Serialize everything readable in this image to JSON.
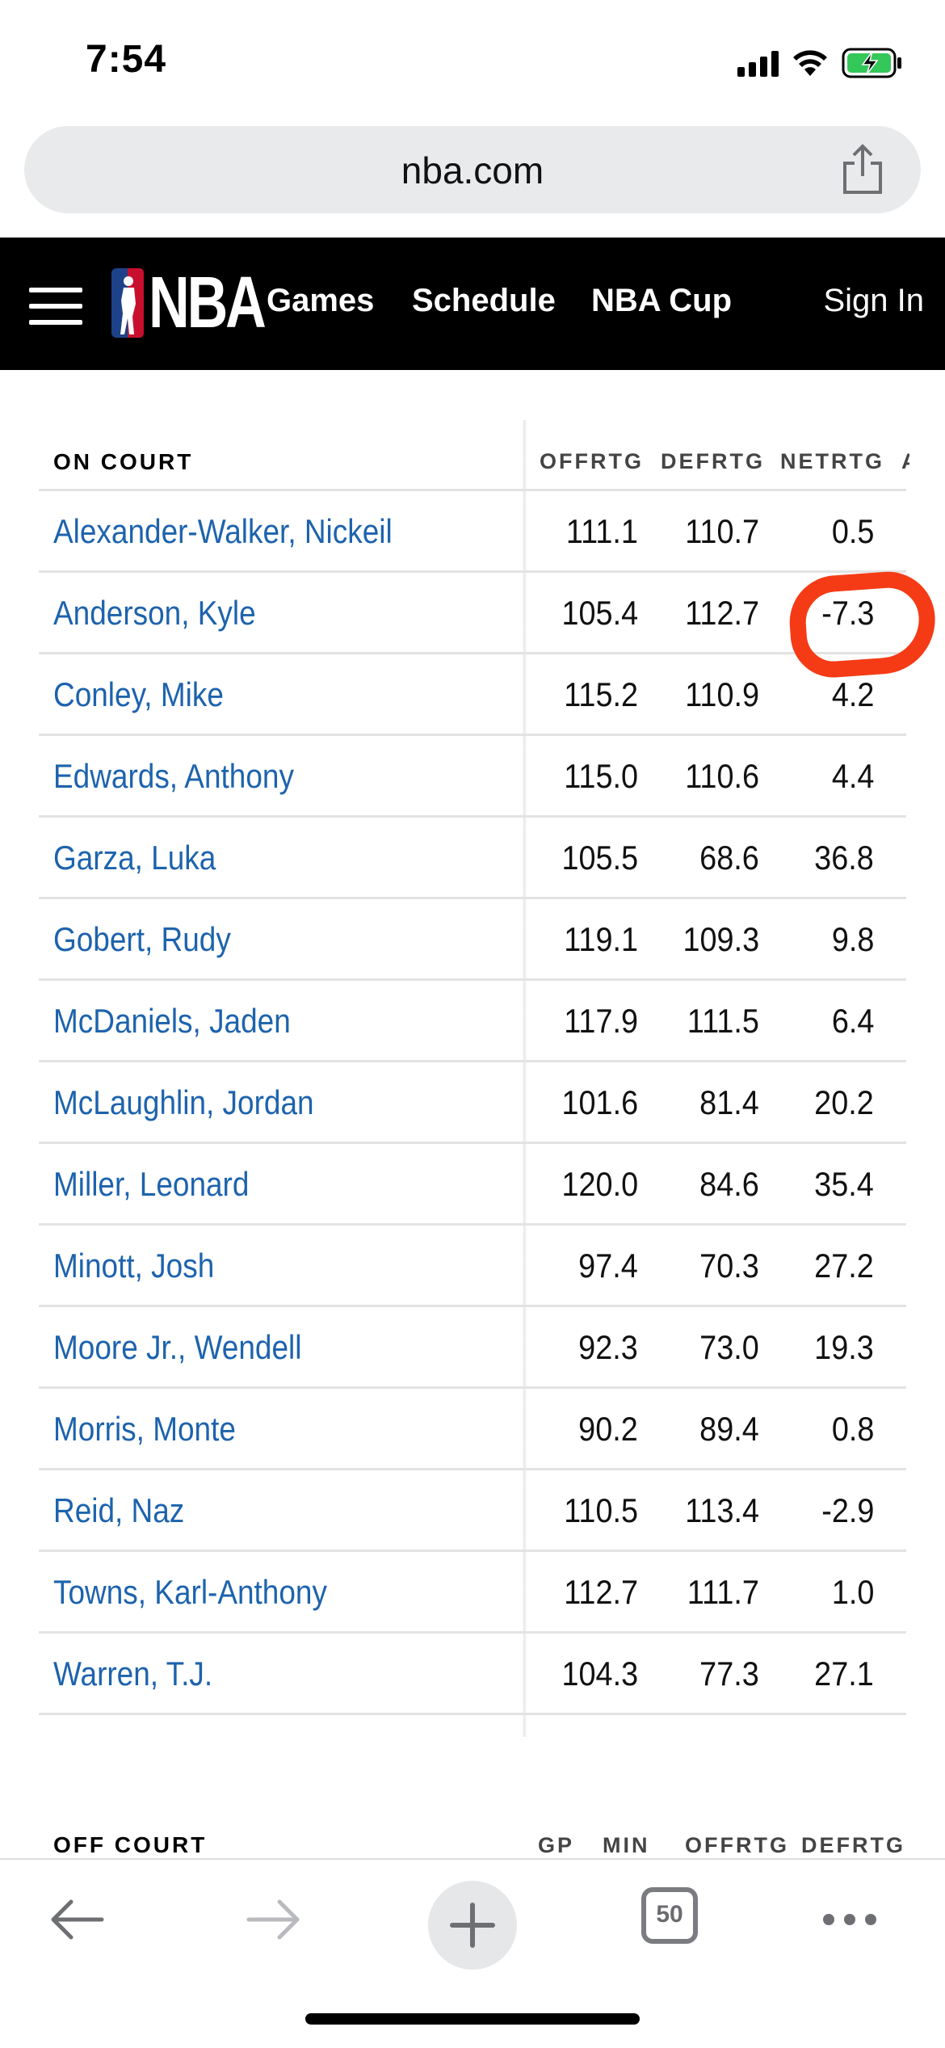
{
  "status_bar": {
    "time": "7:54"
  },
  "browser": {
    "url": "nba.com",
    "tab_count": "50"
  },
  "nav": {
    "logo_text": "NBA",
    "links": [
      "Games",
      "Schedule",
      "NBA Cup"
    ],
    "sign_in": "Sign In"
  },
  "on_court": {
    "title": "ON COURT",
    "columns": [
      "OFFRTG",
      "DEFRTG",
      "NETRTG"
    ],
    "rows": [
      {
        "player": "Alexander-Walker, Nickeil",
        "offrtg": "111.1",
        "defrtg": "110.7",
        "netrtg": "0.5"
      },
      {
        "player": "Anderson, Kyle",
        "offrtg": "105.4",
        "defrtg": "112.7",
        "netrtg": "-7.3"
      },
      {
        "player": "Conley, Mike",
        "offrtg": "115.2",
        "defrtg": "110.9",
        "netrtg": "4.2"
      },
      {
        "player": "Edwards, Anthony",
        "offrtg": "115.0",
        "defrtg": "110.6",
        "netrtg": "4.4"
      },
      {
        "player": "Garza, Luka",
        "offrtg": "105.5",
        "defrtg": "68.6",
        "netrtg": "36.8"
      },
      {
        "player": "Gobert, Rudy",
        "offrtg": "119.1",
        "defrtg": "109.3",
        "netrtg": "9.8"
      },
      {
        "player": "McDaniels, Jaden",
        "offrtg": "117.9",
        "defrtg": "111.5",
        "netrtg": "6.4"
      },
      {
        "player": "McLaughlin, Jordan",
        "offrtg": "101.6",
        "defrtg": "81.4",
        "netrtg": "20.2"
      },
      {
        "player": "Miller, Leonard",
        "offrtg": "120.0",
        "defrtg": "84.6",
        "netrtg": "35.4"
      },
      {
        "player": "Minott, Josh",
        "offrtg": "97.4",
        "defrtg": "70.3",
        "netrtg": "27.2"
      },
      {
        "player": "Moore Jr., Wendell",
        "offrtg": "92.3",
        "defrtg": "73.0",
        "netrtg": "19.3"
      },
      {
        "player": "Morris, Monte",
        "offrtg": "90.2",
        "defrtg": "89.4",
        "netrtg": "0.8"
      },
      {
        "player": "Reid, Naz",
        "offrtg": "110.5",
        "defrtg": "113.4",
        "netrtg": "-2.9"
      },
      {
        "player": "Towns, Karl-Anthony",
        "offrtg": "112.7",
        "defrtg": "111.7",
        "netrtg": "1.0"
      },
      {
        "player": "Warren, T.J.",
        "offrtg": "104.3",
        "defrtg": "77.3",
        "netrtg": "27.1"
      }
    ]
  },
  "off_court": {
    "title": "OFF COURT",
    "columns": [
      "GP",
      "MIN",
      "OFFRTG",
      "DEFRTG"
    ]
  },
  "annotation": {
    "color": "#f53b16"
  },
  "colors": {
    "link": "#1d63ad",
    "nav_bg": "#000000",
    "url_bar_bg": "#e9eaec"
  }
}
